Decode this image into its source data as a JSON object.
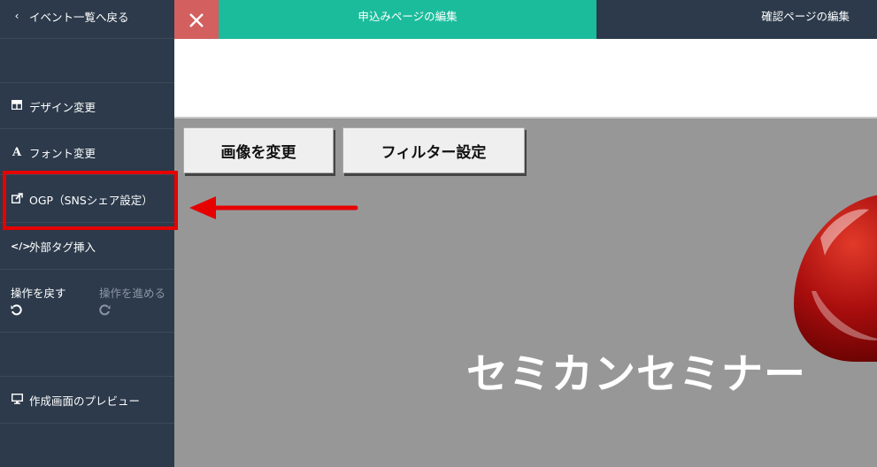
{
  "sidebar": {
    "back_label": "イベント一覧へ戻る",
    "items": [
      {
        "label": "デザイン変更",
        "icon": "grid-icon"
      },
      {
        "label": "フォント変更",
        "icon": "font-icon"
      },
      {
        "label": "OGP（SNSシェア設定）",
        "icon": "share-icon"
      },
      {
        "label": "外部タグ挿入",
        "icon": "code-icon"
      }
    ],
    "undo_label": "操作を戻す",
    "redo_label": "操作を進める",
    "preview_label": "作成画面のプレビュー"
  },
  "header": {
    "tab_edit_apply": "申込みページの編集",
    "tab_edit_confirm": "確認ページの編集"
  },
  "canvas": {
    "change_image_button": "画像を変更",
    "filter_button": "フィルター設定",
    "title": "セミカンセミナー"
  },
  "colors": {
    "sidebar_bg": "#2c3a4b",
    "active_tab": "#1bbc9b",
    "close_button": "#d35f5f",
    "highlight": "#e60000"
  }
}
